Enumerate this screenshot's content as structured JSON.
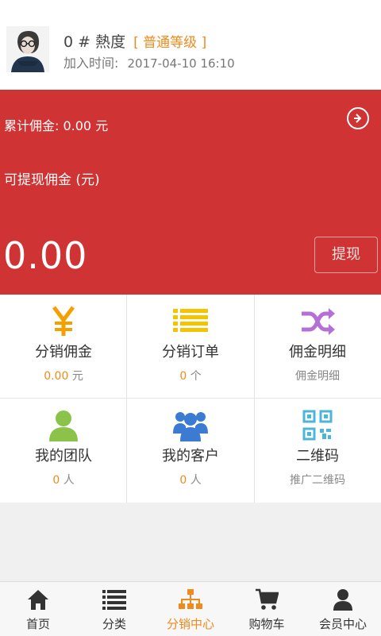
{
  "header": {
    "user_name": "0 # 熱度",
    "level": "[ 普通等级 ]",
    "join_label": "加入时间:",
    "join_time": "2017-04-10 16:10"
  },
  "commission": {
    "total_text": "累计佣金: 0.00 元",
    "withdrawable_label": "可提现佣金 (元)",
    "withdrawable_amount": "0.00",
    "withdraw_button": "提现"
  },
  "grid": [
    {
      "label": "分销佣金",
      "value": "0.00",
      "unit": "元",
      "icon": "yen-icon",
      "color": "#f5a000"
    },
    {
      "label": "分销订单",
      "value": "0",
      "unit": "个",
      "icon": "list-icon",
      "color": "#f5c400"
    },
    {
      "label": "佣金明细",
      "sub": "佣金明细",
      "icon": "shuffle-icon",
      "color": "#b66fd6"
    },
    {
      "label": "我的团队",
      "value": "0",
      "unit": "人",
      "icon": "user-icon",
      "color": "#8bc34a"
    },
    {
      "label": "我的客户",
      "value": "0",
      "unit": "人",
      "icon": "users-icon",
      "color": "#3b7bd4"
    },
    {
      "label": "二维码",
      "sub": "推广二维码",
      "icon": "qrcode-icon",
      "color": "#4cb6d8"
    }
  ],
  "tabs": [
    {
      "label": "首页",
      "icon": "home-icon"
    },
    {
      "label": "分类",
      "icon": "list-icon"
    },
    {
      "label": "分销中心",
      "icon": "org-chart-icon",
      "active": true
    },
    {
      "label": "购物车",
      "icon": "cart-icon"
    },
    {
      "label": "会员中心",
      "icon": "user-icon"
    }
  ],
  "colors": {
    "accent": "#f08a1c",
    "banner": "#d03333"
  }
}
